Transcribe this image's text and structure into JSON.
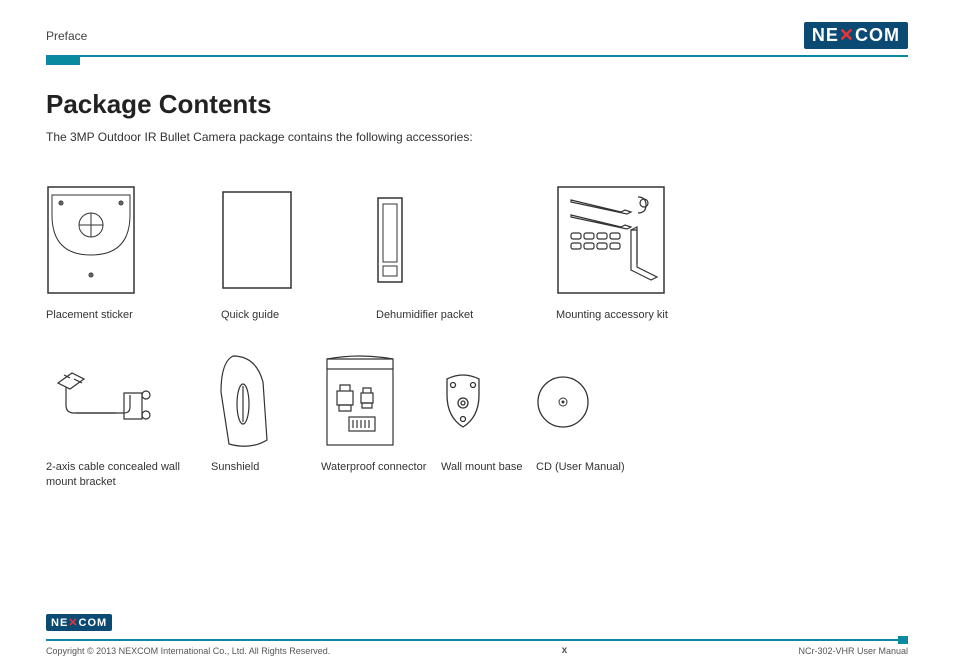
{
  "header": {
    "section": "Preface",
    "logo_text": "NEXCOM"
  },
  "title": "Package Contents",
  "intro": "The 3MP Outdoor IR Bullet Camera package contains the following accessories:",
  "row1": [
    {
      "label": "Placement sticker"
    },
    {
      "label": "Quick guide"
    },
    {
      "label": "Dehumidifier packet"
    },
    {
      "label": "Mounting accessory kit"
    }
  ],
  "row2": [
    {
      "label": "2-axis cable concealed wall mount bracket"
    },
    {
      "label": "Sunshield"
    },
    {
      "label": "Waterproof connector"
    },
    {
      "label": "Wall mount base"
    },
    {
      "label": "CD (User Manual)"
    }
  ],
  "footer": {
    "logo_text": "NEXCOM",
    "copyright": "Copyright © 2013 NEXCOM International Co., Ltd. All Rights Reserved.",
    "page": "x",
    "doc": "NCr-302-VHR User Manual"
  }
}
